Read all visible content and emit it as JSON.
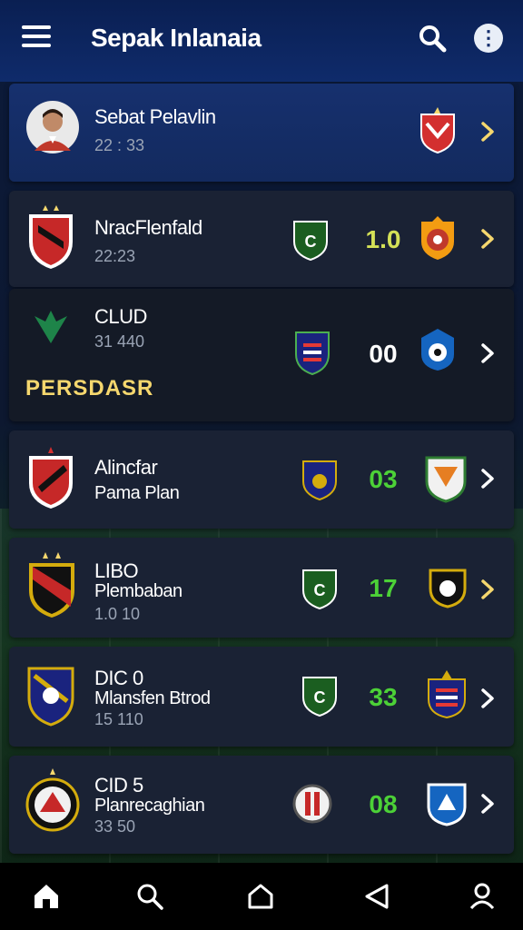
{
  "header": {
    "title": "Sepak Inlanaia"
  },
  "featured": {
    "name": "Sebat Pelavlin",
    "time": "22 : 33"
  },
  "matches": [
    {
      "name": "NracFlenfald",
      "sub": "",
      "time": "22:23",
      "score": "1.0",
      "score_color": "yellow-green"
    },
    {
      "name": "CLUD",
      "sub": "",
      "time": "31 440",
      "score": "00",
      "score_color": "white",
      "promo": "PERSDASR"
    },
    {
      "name": "Alincfar",
      "sub": "Pama Plan",
      "time": "",
      "score": "03",
      "score_color": "green"
    },
    {
      "name": "LIBO",
      "sub": "Plembaban",
      "time": "1.0 10",
      "score": "17",
      "score_color": "green"
    },
    {
      "name": "DIC 0",
      "sub": "Mlansfen Btrod",
      "time": "15 110",
      "score": "33",
      "score_color": "green"
    },
    {
      "name": "CID 5",
      "sub": "Planrecaghian",
      "time": "33 50",
      "score": "08",
      "score_color": "green"
    }
  ],
  "icons": {
    "menu": "menu-icon",
    "search": "search-icon",
    "more": "more-vertical-icon",
    "chevron": "chevron-right-icon",
    "home": "home-icon",
    "nav_search": "search-icon",
    "house": "house-outline-icon",
    "back": "back-triangle-icon",
    "profile": "profile-icon"
  },
  "colors": {
    "header": "#0f2b6b",
    "score_green": "#4cd137",
    "score_yellow": "#d4e157",
    "chevron_yellow": "#f5d76e",
    "promo": "#f5d76e"
  }
}
